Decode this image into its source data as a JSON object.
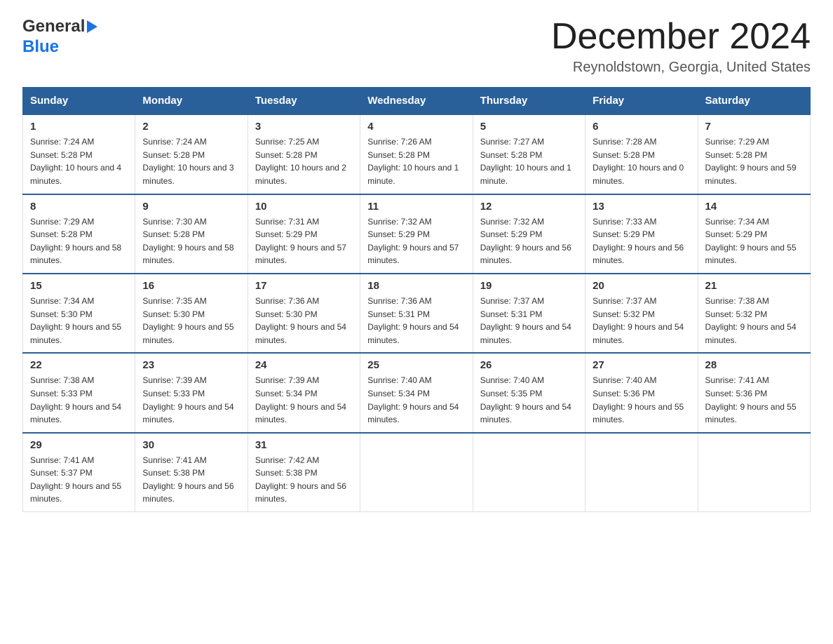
{
  "header": {
    "logo_general": "General",
    "logo_blue": "Blue",
    "month_title": "December 2024",
    "location": "Reynoldstown, Georgia, United States"
  },
  "days_of_week": [
    "Sunday",
    "Monday",
    "Tuesday",
    "Wednesday",
    "Thursday",
    "Friday",
    "Saturday"
  ],
  "weeks": [
    [
      {
        "day": "1",
        "sunrise": "7:24 AM",
        "sunset": "5:28 PM",
        "daylight": "10 hours and 4 minutes."
      },
      {
        "day": "2",
        "sunrise": "7:24 AM",
        "sunset": "5:28 PM",
        "daylight": "10 hours and 3 minutes."
      },
      {
        "day": "3",
        "sunrise": "7:25 AM",
        "sunset": "5:28 PM",
        "daylight": "10 hours and 2 minutes."
      },
      {
        "day": "4",
        "sunrise": "7:26 AM",
        "sunset": "5:28 PM",
        "daylight": "10 hours and 1 minute."
      },
      {
        "day": "5",
        "sunrise": "7:27 AM",
        "sunset": "5:28 PM",
        "daylight": "10 hours and 1 minute."
      },
      {
        "day": "6",
        "sunrise": "7:28 AM",
        "sunset": "5:28 PM",
        "daylight": "10 hours and 0 minutes."
      },
      {
        "day": "7",
        "sunrise": "7:29 AM",
        "sunset": "5:28 PM",
        "daylight": "9 hours and 59 minutes."
      }
    ],
    [
      {
        "day": "8",
        "sunrise": "7:29 AM",
        "sunset": "5:28 PM",
        "daylight": "9 hours and 58 minutes."
      },
      {
        "day": "9",
        "sunrise": "7:30 AM",
        "sunset": "5:28 PM",
        "daylight": "9 hours and 58 minutes."
      },
      {
        "day": "10",
        "sunrise": "7:31 AM",
        "sunset": "5:29 PM",
        "daylight": "9 hours and 57 minutes."
      },
      {
        "day": "11",
        "sunrise": "7:32 AM",
        "sunset": "5:29 PM",
        "daylight": "9 hours and 57 minutes."
      },
      {
        "day": "12",
        "sunrise": "7:32 AM",
        "sunset": "5:29 PM",
        "daylight": "9 hours and 56 minutes."
      },
      {
        "day": "13",
        "sunrise": "7:33 AM",
        "sunset": "5:29 PM",
        "daylight": "9 hours and 56 minutes."
      },
      {
        "day": "14",
        "sunrise": "7:34 AM",
        "sunset": "5:29 PM",
        "daylight": "9 hours and 55 minutes."
      }
    ],
    [
      {
        "day": "15",
        "sunrise": "7:34 AM",
        "sunset": "5:30 PM",
        "daylight": "9 hours and 55 minutes."
      },
      {
        "day": "16",
        "sunrise": "7:35 AM",
        "sunset": "5:30 PM",
        "daylight": "9 hours and 55 minutes."
      },
      {
        "day": "17",
        "sunrise": "7:36 AM",
        "sunset": "5:30 PM",
        "daylight": "9 hours and 54 minutes."
      },
      {
        "day": "18",
        "sunrise": "7:36 AM",
        "sunset": "5:31 PM",
        "daylight": "9 hours and 54 minutes."
      },
      {
        "day": "19",
        "sunrise": "7:37 AM",
        "sunset": "5:31 PM",
        "daylight": "9 hours and 54 minutes."
      },
      {
        "day": "20",
        "sunrise": "7:37 AM",
        "sunset": "5:32 PM",
        "daylight": "9 hours and 54 minutes."
      },
      {
        "day": "21",
        "sunrise": "7:38 AM",
        "sunset": "5:32 PM",
        "daylight": "9 hours and 54 minutes."
      }
    ],
    [
      {
        "day": "22",
        "sunrise": "7:38 AM",
        "sunset": "5:33 PM",
        "daylight": "9 hours and 54 minutes."
      },
      {
        "day": "23",
        "sunrise": "7:39 AM",
        "sunset": "5:33 PM",
        "daylight": "9 hours and 54 minutes."
      },
      {
        "day": "24",
        "sunrise": "7:39 AM",
        "sunset": "5:34 PM",
        "daylight": "9 hours and 54 minutes."
      },
      {
        "day": "25",
        "sunrise": "7:40 AM",
        "sunset": "5:34 PM",
        "daylight": "9 hours and 54 minutes."
      },
      {
        "day": "26",
        "sunrise": "7:40 AM",
        "sunset": "5:35 PM",
        "daylight": "9 hours and 54 minutes."
      },
      {
        "day": "27",
        "sunrise": "7:40 AM",
        "sunset": "5:36 PM",
        "daylight": "9 hours and 55 minutes."
      },
      {
        "day": "28",
        "sunrise": "7:41 AM",
        "sunset": "5:36 PM",
        "daylight": "9 hours and 55 minutes."
      }
    ],
    [
      {
        "day": "29",
        "sunrise": "7:41 AM",
        "sunset": "5:37 PM",
        "daylight": "9 hours and 55 minutes."
      },
      {
        "day": "30",
        "sunrise": "7:41 AM",
        "sunset": "5:38 PM",
        "daylight": "9 hours and 56 minutes."
      },
      {
        "day": "31",
        "sunrise": "7:42 AM",
        "sunset": "5:38 PM",
        "daylight": "9 hours and 56 minutes."
      },
      null,
      null,
      null,
      null
    ]
  ],
  "labels": {
    "sunrise": "Sunrise:",
    "sunset": "Sunset:",
    "daylight": "Daylight:"
  }
}
